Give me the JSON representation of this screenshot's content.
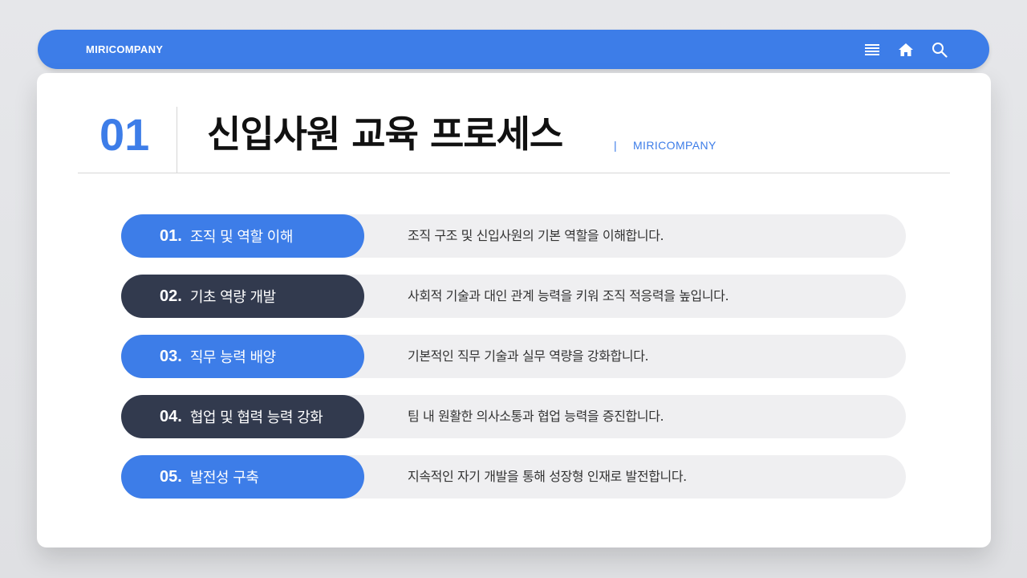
{
  "header": {
    "brand": "MIRICOMPANY",
    "icons": [
      "menu-icon",
      "home-icon",
      "search-icon"
    ]
  },
  "title_block": {
    "section_number": "01",
    "title": "신입사원 교육 프로세스",
    "separator": "|",
    "subtitle": "MIRICOMPANY"
  },
  "colors": {
    "accent": "#3d7de8",
    "dark": "#323a4e",
    "row_background": "#efeff1"
  },
  "steps": [
    {
      "num": "01.",
      "label": "조직 및 역할 이해",
      "desc": "조직 구조 및 신입사원의 기본 역할을 이해합니다.",
      "style": "blue"
    },
    {
      "num": "02.",
      "label": "기초 역량 개발",
      "desc": "사회적 기술과 대인 관계 능력을 키워 조직 적응력을 높입니다.",
      "style": "dark"
    },
    {
      "num": "03.",
      "label": "직무 능력 배양",
      "desc": "기본적인 직무 기술과 실무 역량을 강화합니다.",
      "style": "blue"
    },
    {
      "num": "04.",
      "label": "협업 및 협력 능력 강화",
      "desc": "팀 내 원활한 의사소통과 협업 능력을 증진합니다.",
      "style": "dark"
    },
    {
      "num": "05.",
      "label": "발전성 구축",
      "desc": "지속적인 자기 개발을 통해 성장형 인재로 발전합니다.",
      "style": "blue"
    }
  ]
}
